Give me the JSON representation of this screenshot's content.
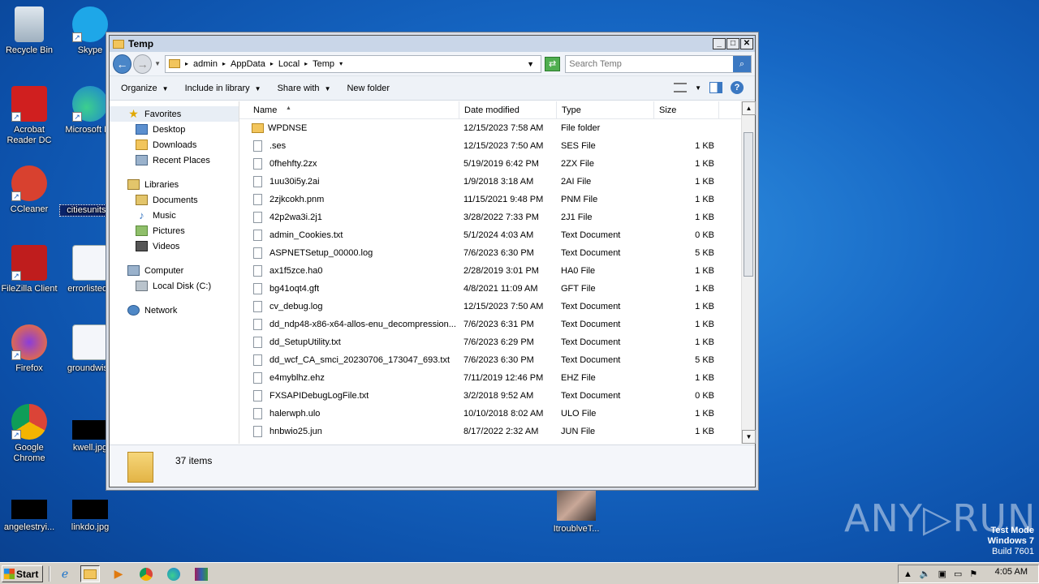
{
  "desktop": {
    "icons": [
      {
        "label": "Recycle Bin"
      },
      {
        "label": "Skype"
      },
      {
        "label": "Acrobat Reader DC"
      },
      {
        "label": "Microsoft Ed"
      },
      {
        "label": "CCleaner"
      },
      {
        "label": "citiesunits.p"
      },
      {
        "label": "FileZilla Client"
      },
      {
        "label": "errorlisted.r"
      },
      {
        "label": "Firefox"
      },
      {
        "label": "groundwish"
      },
      {
        "label": "Google Chrome"
      },
      {
        "label": "kwell.jpg"
      },
      {
        "label": "angelestryi..."
      },
      {
        "label": "linkdo.jpg"
      },
      {
        "label": "ItroublveT..."
      }
    ]
  },
  "window": {
    "title": "Temp",
    "controls": {
      "minimize": "_",
      "maximize": "□",
      "close": "✕"
    },
    "breadcrumb": [
      "admin",
      "AppData",
      "Local",
      "Temp"
    ],
    "search_placeholder": "Search Temp",
    "commands": {
      "organize": "Organize",
      "include_in_library": "Include in library",
      "share_with": "Share with",
      "new_folder": "New folder"
    },
    "nav": {
      "favorites": "Favorites",
      "desktop": "Desktop",
      "downloads": "Downloads",
      "recent_places": "Recent Places",
      "libraries": "Libraries",
      "documents": "Documents",
      "music": "Music",
      "pictures": "Pictures",
      "videos": "Videos",
      "computer": "Computer",
      "local_disk": "Local Disk (C:)",
      "network": "Network"
    },
    "columns": {
      "name": "Name",
      "date": "Date modified",
      "type": "Type",
      "size": "Size"
    },
    "files": [
      {
        "name": "WPDNSE",
        "date": "12/15/2023 7:58 AM",
        "type": "File folder",
        "size": ""
      },
      {
        "name": ".ses",
        "date": "12/15/2023 7:50 AM",
        "type": "SES File",
        "size": "1 KB"
      },
      {
        "name": "0fhehfty.2zx",
        "date": "5/19/2019 6:42 PM",
        "type": "2ZX File",
        "size": "1 KB"
      },
      {
        "name": "1uu30i5y.2ai",
        "date": "1/9/2018 3:18 AM",
        "type": "2AI File",
        "size": "1 KB"
      },
      {
        "name": "2zjkcokh.pnm",
        "date": "11/15/2021 9:48 PM",
        "type": "PNM File",
        "size": "1 KB"
      },
      {
        "name": "42p2wa3i.2j1",
        "date": "3/28/2022 7:33 PM",
        "type": "2J1 File",
        "size": "1 KB"
      },
      {
        "name": "admin_Cookies.txt",
        "date": "5/1/2024 4:03 AM",
        "type": "Text Document",
        "size": "0 KB"
      },
      {
        "name": "ASPNETSetup_00000.log",
        "date": "7/6/2023 6:30 PM",
        "type": "Text Document",
        "size": "5 KB"
      },
      {
        "name": "ax1f5zce.ha0",
        "date": "2/28/2019 3:01 PM",
        "type": "HA0 File",
        "size": "1 KB"
      },
      {
        "name": "bg41oqt4.gft",
        "date": "4/8/2021 11:09 AM",
        "type": "GFT File",
        "size": "1 KB"
      },
      {
        "name": "cv_debug.log",
        "date": "12/15/2023 7:50 AM",
        "type": "Text Document",
        "size": "1 KB"
      },
      {
        "name": "dd_ndp48-x86-x64-allos-enu_decompression...",
        "date": "7/6/2023 6:31 PM",
        "type": "Text Document",
        "size": "1 KB"
      },
      {
        "name": "dd_SetupUtility.txt",
        "date": "7/6/2023 6:29 PM",
        "type": "Text Document",
        "size": "1 KB"
      },
      {
        "name": "dd_wcf_CA_smci_20230706_173047_693.txt",
        "date": "7/6/2023 6:30 PM",
        "type": "Text Document",
        "size": "5 KB"
      },
      {
        "name": "e4myblhz.ehz",
        "date": "7/11/2019 12:46 PM",
        "type": "EHZ File",
        "size": "1 KB"
      },
      {
        "name": "FXSAPIDebugLogFile.txt",
        "date": "3/2/2018 9:52 AM",
        "type": "Text Document",
        "size": "0 KB"
      },
      {
        "name": "halerwph.ulo",
        "date": "10/10/2018 8:02 AM",
        "type": "ULO File",
        "size": "1 KB"
      },
      {
        "name": "hnbwio25.jun",
        "date": "8/17/2022 2:32 AM",
        "type": "JUN File",
        "size": "1 KB"
      }
    ],
    "status": {
      "item_count": "37 items"
    }
  },
  "taskbar": {
    "start": "Start",
    "clock": "4:05 AM"
  },
  "watermark": {
    "line1": "Test Mode",
    "line2": "Windows 7",
    "line3": "Build 7601",
    "brand": "ANY RUN"
  }
}
